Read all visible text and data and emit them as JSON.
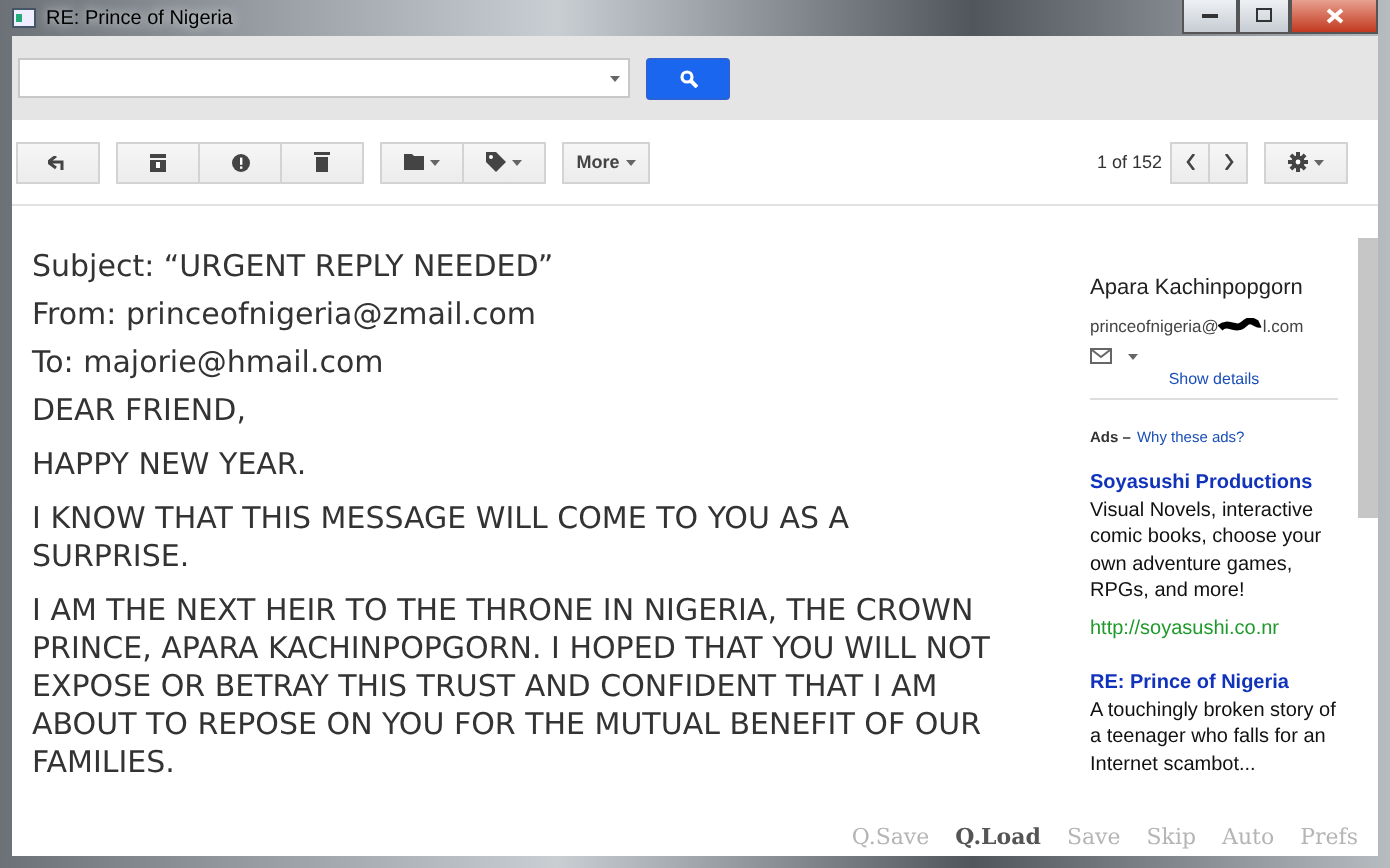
{
  "window": {
    "title": "RE: Prince of Nigeria"
  },
  "toolbar": {
    "more_label": "More",
    "page_info": "1 of 152"
  },
  "email": {
    "header_lines": [
      "Subject: “URGENT REPLY NEEDED”",
      "From: princeofnigeria@zmail.com",
      "To: majorie@hmail.com"
    ],
    "paragraphs": [
      "DEAR FRIEND,",
      "HAPPY NEW YEAR.",
      "I KNOW THAT THIS MESSAGE WILL COME TO YOU AS A SURPRISE.",
      "I AM THE NEXT HEIR TO THE THRONE IN NIGERIA, THE CROWN PRINCE, APARA KACHINPOPGORN. I HOPED THAT YOU WILL NOT EXPOSE OR BETRAY THIS TRUST AND CONFIDENT THAT I AM ABOUT TO REPOSE ON YOU FOR THE MUTUAL BENEFIT OF OUR FAMILIES."
    ]
  },
  "sidebar": {
    "sender_name": "Apara Kachinpopgorn",
    "email_start": "princeofnigeria@",
    "email_end": "l.com",
    "show_details": "Show details",
    "ads_label": "Ads –",
    "ads_link": "Why these ads?",
    "ads": [
      {
        "title": "Soyasushi Productions",
        "text": "Visual Novels, interactive comic books, choose your own adventure games, RPGs, and more!",
        "url": "http://soyasushi.co.nr"
      },
      {
        "title": "RE: Prince of Nigeria",
        "text": "A touchingly broken story of a teenager who falls for an Internet scambot..."
      }
    ]
  },
  "quick_menu": [
    {
      "label": "Q.Save",
      "active": false
    },
    {
      "label": "Q.Load",
      "active": true
    },
    {
      "label": "Save",
      "active": false
    },
    {
      "label": "Skip",
      "active": false
    },
    {
      "label": "Auto",
      "active": false
    },
    {
      "label": "Prefs",
      "active": false
    }
  ]
}
